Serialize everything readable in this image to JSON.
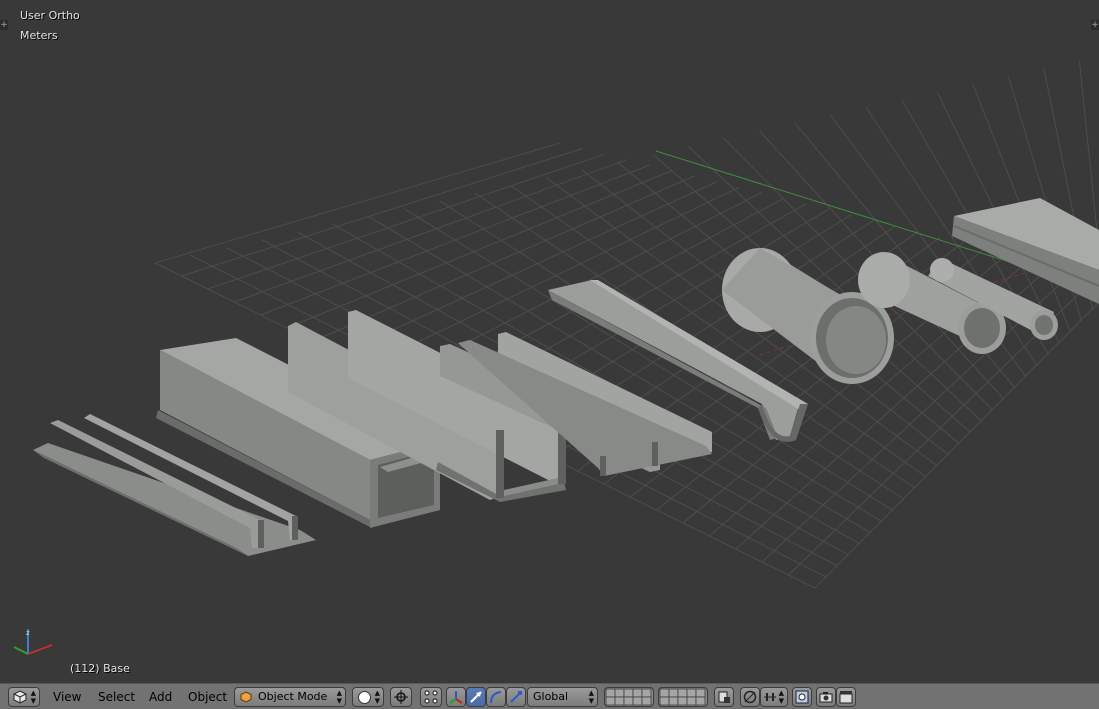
{
  "viewport": {
    "view_label": "User Ortho",
    "units_label": "Meters",
    "frame_label": "(112) Base",
    "background": "#393939",
    "grid_color": "#4e4e4e",
    "x_axis_color": "#8a3a3a",
    "y_axis_color": "#3f8a3f",
    "mesh_color": "#8f918e"
  },
  "header": {
    "editor_type_icon": "3d-view-cube-icon",
    "menus": [
      "View",
      "Select",
      "Add",
      "Object"
    ],
    "mode": "Object Mode",
    "shading_icon": "solid-sphere-icon",
    "pivot_icon": "pivot-point-icon",
    "manipulator_icons": [
      "translate-icon",
      "rotate-icon",
      "scale-icon"
    ],
    "orientation": "Global",
    "layer_icons": [
      "layers-grid-icon",
      "layers-grid-icon"
    ],
    "trailing_icons": [
      "lock-layers-icon",
      "proportional-editing-icon",
      "snap-icon",
      "snap-target-icon",
      "render-camera-icon",
      "render-anim-icon"
    ]
  }
}
